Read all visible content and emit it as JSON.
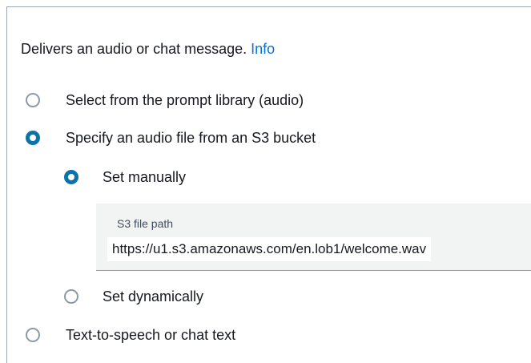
{
  "description": {
    "text": "Delivers an audio or chat message.",
    "info_link": "Info"
  },
  "options": {
    "prompt_library": "Select from the prompt library (audio)",
    "s3_bucket": "Specify an audio file from an S3 bucket",
    "set_manually": "Set manually",
    "set_dynamically": "Set dynamically",
    "text_to_speech": "Text-to-speech or chat text"
  },
  "s3_field": {
    "label": "S3 file path",
    "value": "https://u1.s3.amazonaws.com/en.lob1/welcome.wav"
  },
  "colors": {
    "accent": "#0b73a8",
    "link": "#0972d3"
  }
}
